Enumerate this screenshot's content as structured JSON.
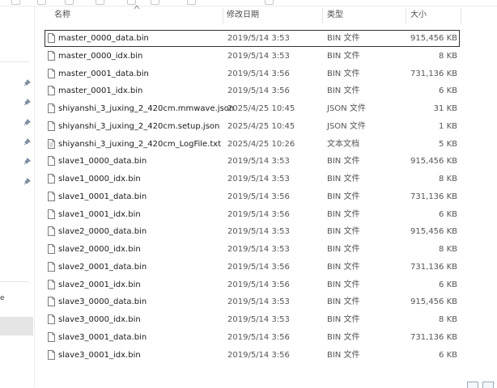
{
  "window": {
    "accent": "#0078d7"
  },
  "columns": {
    "name": "名称",
    "date": "修改日期",
    "type": "类型",
    "size": "大小"
  },
  "nav": {
    "truncated_label": "e",
    "pinned_count": 6
  },
  "files": [
    {
      "name": "master_0000_data.bin",
      "date": "2019/5/14 3:53",
      "type": "BIN 文件",
      "size": "915,456 KB",
      "icon": "file-icon",
      "focused": true
    },
    {
      "name": "master_0000_idx.bin",
      "date": "2019/5/14 3:53",
      "type": "BIN 文件",
      "size": "8 KB",
      "icon": "file-icon"
    },
    {
      "name": "master_0001_data.bin",
      "date": "2019/5/14 3:56",
      "type": "BIN 文件",
      "size": "731,136 KB",
      "icon": "file-icon"
    },
    {
      "name": "master_0001_idx.bin",
      "date": "2019/5/14 3:56",
      "type": "BIN 文件",
      "size": "6 KB",
      "icon": "file-icon"
    },
    {
      "name": "shiyanshi_3_juxing_2_420cm.mmwave.json",
      "date": "2025/4/25 10:45",
      "type": "JSON 文件",
      "size": "31 KB",
      "icon": "file-icon"
    },
    {
      "name": "shiyanshi_3_juxing_2_420cm.setup.json",
      "date": "2025/4/25 10:45",
      "type": "JSON 文件",
      "size": "1 KB",
      "icon": "file-icon"
    },
    {
      "name": "shiyanshi_3_juxing_2_420cm_LogFile.txt",
      "date": "2025/4/25 10:26",
      "type": "文本文档",
      "size": "5 KB",
      "icon": "text-file-icon"
    },
    {
      "name": "slave1_0000_data.bin",
      "date": "2019/5/14 3:53",
      "type": "BIN 文件",
      "size": "915,456 KB",
      "icon": "file-icon"
    },
    {
      "name": "slave1_0000_idx.bin",
      "date": "2019/5/14 3:53",
      "type": "BIN 文件",
      "size": "8 KB",
      "icon": "file-icon"
    },
    {
      "name": "slave1_0001_data.bin",
      "date": "2019/5/14 3:56",
      "type": "BIN 文件",
      "size": "731,136 KB",
      "icon": "file-icon"
    },
    {
      "name": "slave1_0001_idx.bin",
      "date": "2019/5/14 3:56",
      "type": "BIN 文件",
      "size": "6 KB",
      "icon": "file-icon"
    },
    {
      "name": "slave2_0000_data.bin",
      "date": "2019/5/14 3:53",
      "type": "BIN 文件",
      "size": "915,456 KB",
      "icon": "file-icon"
    },
    {
      "name": "slave2_0000_idx.bin",
      "date": "2019/5/14 3:53",
      "type": "BIN 文件",
      "size": "8 KB",
      "icon": "file-icon"
    },
    {
      "name": "slave2_0001_data.bin",
      "date": "2019/5/14 3:56",
      "type": "BIN 文件",
      "size": "731,136 KB",
      "icon": "file-icon"
    },
    {
      "name": "slave2_0001_idx.bin",
      "date": "2019/5/14 3:56",
      "type": "BIN 文件",
      "size": "6 KB",
      "icon": "file-icon"
    },
    {
      "name": "slave3_0000_data.bin",
      "date": "2019/5/14 3:53",
      "type": "BIN 文件",
      "size": "915,456 KB",
      "icon": "file-icon"
    },
    {
      "name": "slave3_0000_idx.bin",
      "date": "2019/5/14 3:53",
      "type": "BIN 文件",
      "size": "8 KB",
      "icon": "file-icon"
    },
    {
      "name": "slave3_0001_data.bin",
      "date": "2019/5/14 3:56",
      "type": "BIN 文件",
      "size": "731,136 KB",
      "icon": "file-icon"
    },
    {
      "name": "slave3_0001_idx.bin",
      "date": "2019/5/14 3:56",
      "type": "BIN 文件",
      "size": "6 KB",
      "icon": "file-icon"
    }
  ]
}
